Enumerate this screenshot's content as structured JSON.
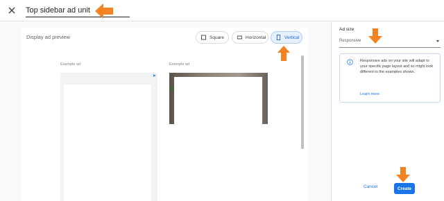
{
  "header": {
    "title_value": "Top sidebar ad unit",
    "close_icon": "close-icon"
  },
  "preview": {
    "heading": "Display ad preview",
    "segments": [
      {
        "label": "Square",
        "icon": "square-icon",
        "selected": false
      },
      {
        "label": "Horizontal",
        "icon": "horizontal-rect-icon",
        "selected": false
      },
      {
        "label": "Vertical",
        "icon": "vertical-rect-icon",
        "selected": true
      }
    ],
    "examples": [
      {
        "label": "Example ad",
        "icon": "adchoices-icon"
      },
      {
        "label": "Example ad"
      }
    ]
  },
  "sidebar": {
    "ad_size_label": "Ad size",
    "ad_size_value": "Responsive",
    "info_text": "Responsive ads on your site will adapt to your specific page layout and so might look different to the examples shown.",
    "learn_more": "Learn more",
    "cancel_label": "Cancel",
    "create_label": "Create"
  },
  "colors": {
    "accent": "#1a73e8",
    "selected_segment_bg": "#e8f0fe",
    "annotation_arrow": "#f58220"
  }
}
